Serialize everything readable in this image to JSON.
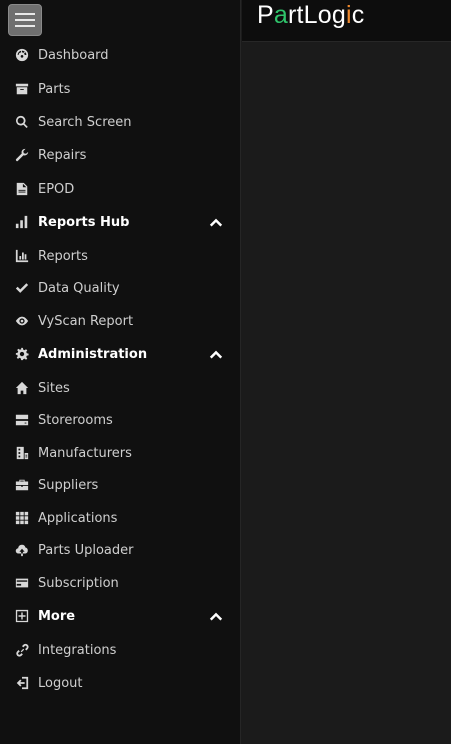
{
  "brand": {
    "logo_p": "P",
    "logo_a": "a",
    "logo_mid": "rtLog",
    "logo_i": "i",
    "logo_c": "c",
    "green": "#2fc46b",
    "orange": "#f0892d"
  },
  "sidebar": {
    "items": [
      {
        "label": "Dashboard",
        "icon": "dashboard-icon"
      },
      {
        "label": "Parts",
        "icon": "box-icon"
      },
      {
        "label": "Search Screen",
        "icon": "search-icon"
      },
      {
        "label": "Repairs",
        "icon": "wrench-icon"
      },
      {
        "label": "EPOD",
        "icon": "document-icon"
      },
      {
        "label": "Reports Hub",
        "icon": "bar-chart-icon",
        "group": true,
        "expanded": true
      },
      {
        "label": "Reports",
        "icon": "report-chart-icon"
      },
      {
        "label": "Data Quality",
        "icon": "check-icon"
      },
      {
        "label": "VyScan Report",
        "icon": "eye-icon"
      },
      {
        "label": "Administration",
        "icon": "gear-icon",
        "group": true,
        "expanded": true
      },
      {
        "label": "Sites",
        "icon": "home-icon"
      },
      {
        "label": "Storerooms",
        "icon": "storage-icon"
      },
      {
        "label": "Manufacturers",
        "icon": "factory-icon"
      },
      {
        "label": "Suppliers",
        "icon": "briefcase-icon"
      },
      {
        "label": "Applications",
        "icon": "grid-icon"
      },
      {
        "label": "Parts Uploader",
        "icon": "cloud-upload-icon"
      },
      {
        "label": "Subscription",
        "icon": "credit-card-icon"
      },
      {
        "label": "More",
        "icon": "plus-square-icon",
        "group": true,
        "expanded": true
      },
      {
        "label": "Integrations",
        "icon": "link-icon"
      },
      {
        "label": "Logout",
        "icon": "logout-icon"
      }
    ]
  }
}
